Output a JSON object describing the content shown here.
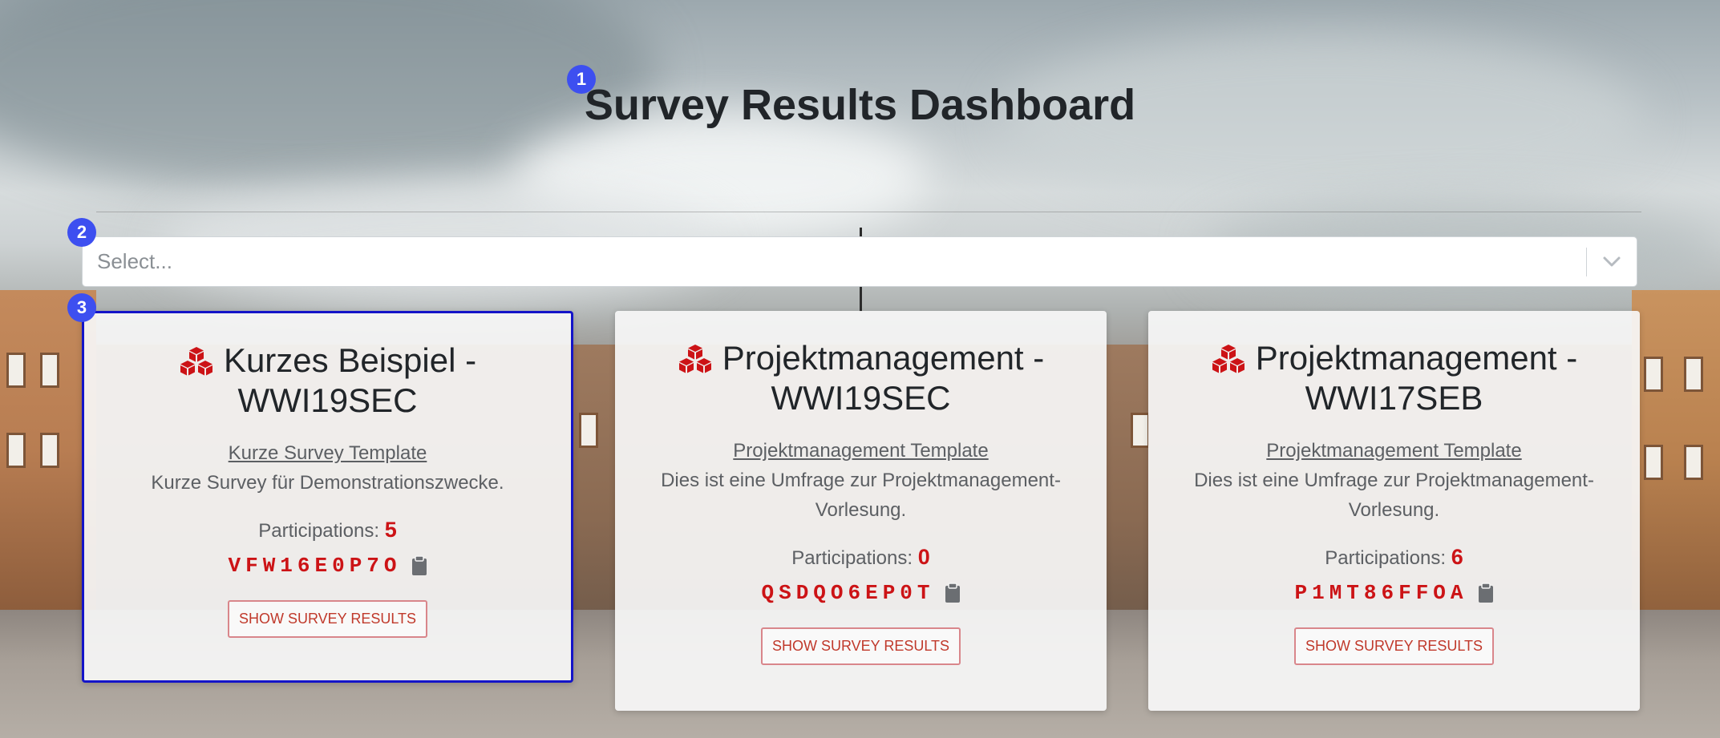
{
  "page": {
    "title": "Survey Results Dashboard"
  },
  "badges": [
    "1",
    "2",
    "3"
  ],
  "select": {
    "placeholder": "Select..."
  },
  "cards": [
    {
      "title": "Kurzes Beispiel - WWI19SEC",
      "template": "Kurze Survey Template",
      "description": "Kurze Survey für Demonstrationszwecke.",
      "participations_label": "Participations:",
      "participations": "5",
      "code": "VFW16E0P7O",
      "button": "SHOW SURVEY RESULTS"
    },
    {
      "title": "Projektmanagement - WWI19SEC",
      "template": "Projektmanagement Template",
      "description": "Dies ist eine Umfrage zur Projektmanagement-Vorlesung.",
      "participations_label": "Participations:",
      "participations": "0",
      "code": "QSDQO6EP0T",
      "button": "SHOW SURVEY RESULTS"
    },
    {
      "title": "Projektmanagement - WWI17SEB",
      "template": "Projektmanagement Template",
      "description": "Dies ist eine Umfrage zur Projektmanagement-Vorlesung.",
      "participations_label": "Participations:",
      "participations": "6",
      "code": "P1MT86FFOA",
      "button": "SHOW SURVEY RESULTS"
    }
  ],
  "colors": {
    "accent_red": "#cc1316",
    "badge_blue": "#3d4ff0",
    "selected_border": "#1414c8"
  },
  "icons": {
    "card_icon": "cubes-icon",
    "copy_icon": "clipboard-icon",
    "select_icon": "chevron-down-icon"
  }
}
